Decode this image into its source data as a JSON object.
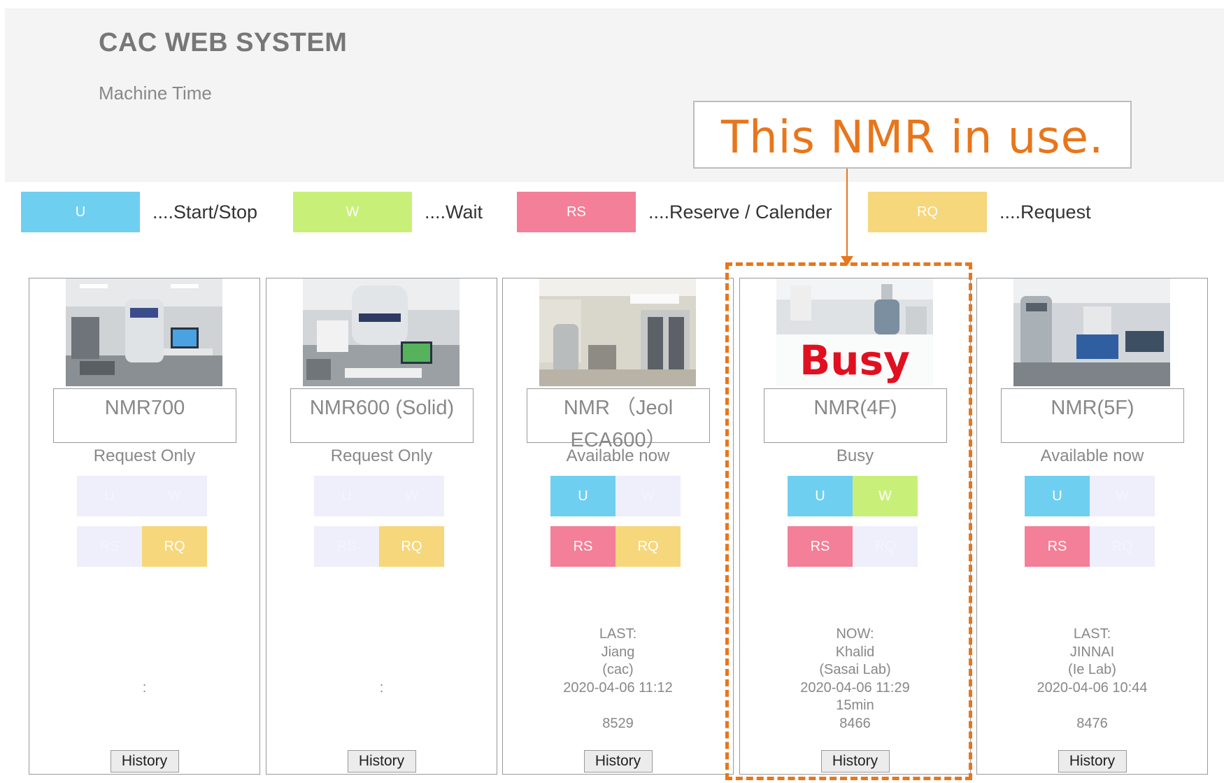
{
  "header": {
    "title": "CAC WEB SYSTEM",
    "subtitle": "Machine Time"
  },
  "callout": {
    "text": "This NMR in use.",
    "color": "#e8761b"
  },
  "legend": [
    {
      "code": "U",
      "label": "....Start/Stop",
      "color": "#6fcff0"
    },
    {
      "code": "W",
      "label": "....Wait",
      "color": "#c8f079"
    },
    {
      "code": "RS",
      "label": "....Reserve / Calender",
      "color": "#f47f98"
    },
    {
      "code": "RQ",
      "label": "....Request",
      "color": "#f6d77c"
    }
  ],
  "cards": [
    {
      "name": "NMR700",
      "status": "Request Only",
      "buttons": {
        "u": "U",
        "w": "W",
        "rs": "RS",
        "rq": "RQ"
      },
      "active": {
        "u": false,
        "w": false,
        "rs": false,
        "rq": true
      },
      "info": {
        "line1": "",
        "line2": "",
        "line3": "",
        "line4": ":",
        "line5": "",
        "line6": ""
      },
      "history_label": "History"
    },
    {
      "name": "NMR600 (Solid)",
      "status": "Request Only",
      "buttons": {
        "u": "U",
        "w": "W",
        "rs": "RS",
        "rq": "RQ"
      },
      "active": {
        "u": false,
        "w": false,
        "rs": false,
        "rq": true
      },
      "info": {
        "line1": "",
        "line2": "",
        "line3": "",
        "line4": ":",
        "line5": "",
        "line6": ""
      },
      "history_label": "History"
    },
    {
      "name": "NMR （Jeol ECA600）",
      "status": "Available now",
      "buttons": {
        "u": "U",
        "w": "W",
        "rs": "RS",
        "rq": "RQ"
      },
      "active": {
        "u": true,
        "w": false,
        "rs": true,
        "rq": true
      },
      "info": {
        "line1": "LAST:",
        "line2": "Jiang",
        "line3": "(cac)",
        "line4": "2020-04-06 11:12",
        "line5": "",
        "line6": "8529"
      },
      "history_label": "History"
    },
    {
      "name": "NMR(4F)",
      "status": "Busy",
      "overlay": "Busy",
      "buttons": {
        "u": "U",
        "w": "W",
        "rs": "RS",
        "rq": "RQ"
      },
      "active": {
        "u": true,
        "w": true,
        "rs": true,
        "rq": false
      },
      "info": {
        "line1": "NOW:",
        "line2": "Khalid",
        "line3": "(Sasai Lab)",
        "line4": "2020-04-06 11:29",
        "line5": "15min",
        "line6": "8466"
      },
      "history_label": "History"
    },
    {
      "name": "NMR(5F)",
      "status": "Available now",
      "buttons": {
        "u": "U",
        "w": "W",
        "rs": "RS",
        "rq": "RQ"
      },
      "active": {
        "u": true,
        "w": false,
        "rs": true,
        "rq": false
      },
      "info": {
        "line1": "LAST:",
        "line2": "JINNAI",
        "line3": "(Ie Lab)",
        "line4": "2020-04-06 10:44",
        "line5": "",
        "line6": "8476"
      },
      "history_label": "History"
    }
  ]
}
